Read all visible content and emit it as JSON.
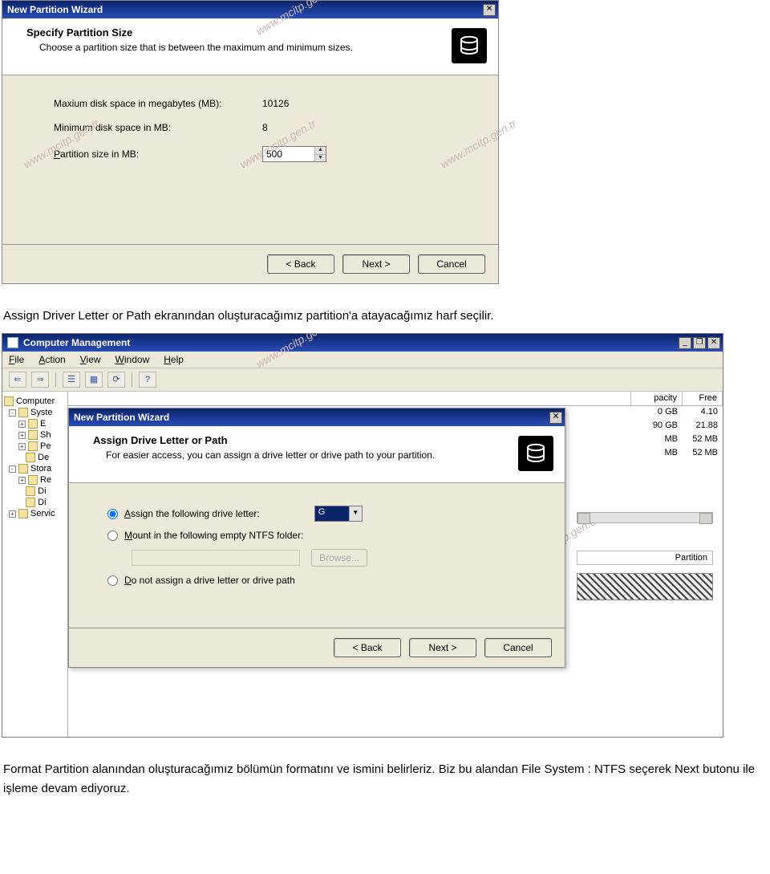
{
  "dialog1": {
    "title": "New Partition Wizard",
    "header_title": "Specify Partition Size",
    "header_sub": "Choose a partition size that is between the maximum and minimum sizes.",
    "max_label": "Maxium disk space in megabytes (MB):",
    "max_value": "10126",
    "min_label": "Minimum disk space in MB:",
    "min_value": "8",
    "size_label_pre": "P",
    "size_label_post": "artition size in MB:",
    "size_value": "500",
    "btn_back": "< Back",
    "btn_next": "Next >",
    "btn_cancel": "Cancel"
  },
  "para1": "Assign Driver Letter or Path ekranından oluşturacağımız partition'a atayacağımız harf seçilir.",
  "cm": {
    "title": "Computer Management",
    "menu": {
      "file": "File",
      "action": "Action",
      "view": "View",
      "window": "Window",
      "help": "Help"
    },
    "tree": {
      "root": "Computer",
      "syste": "Syste",
      "e": "E",
      "sh": "Sh",
      "pe": "Pe",
      "de": "De",
      "stora": "Stora",
      "re": "Re",
      "di": "Di",
      "di2": "Di",
      "servi": "Servic"
    },
    "columns": {
      "c2": "pacity",
      "c3": "Free"
    },
    "rows": [
      {
        "c1": "",
        "c2": "0 GB",
        "c3": "4.10"
      },
      {
        "c1": "",
        "c2": "90 GB",
        "c3": "21.88"
      },
      {
        "c1": "",
        "c2": "MB",
        "c3": "52 MB"
      },
      {
        "c1": "",
        "c2": "MB",
        "c3": "52 MB"
      }
    ],
    "partition_label": "Partition"
  },
  "dialog2": {
    "title": "New Partition Wizard",
    "header_title": "Assign Drive Letter or Path",
    "header_sub": "For easier access, you can assign a drive letter or drive path to your partition.",
    "opt1_pre": "A",
    "opt1_post": "ssign the following drive letter:",
    "opt1_value": "G",
    "opt2_pre": "M",
    "opt2_post": "ount in the following empty NTFS folder:",
    "opt2_browse": "Browse...",
    "opt3_pre": "D",
    "opt3_post": "o not assign a drive letter or drive path",
    "btn_back": "< Back",
    "btn_next": "Next >",
    "btn_cancel": "Cancel"
  },
  "para2": "Format Partition alanından oluşturacağımız bölümün formatını ve ismini belirleriz. Biz bu alandan File System : NTFS seçerek Next butonu ile işleme devam ediyoruz.",
  "watermark": "www.mcitp.gen.tr"
}
